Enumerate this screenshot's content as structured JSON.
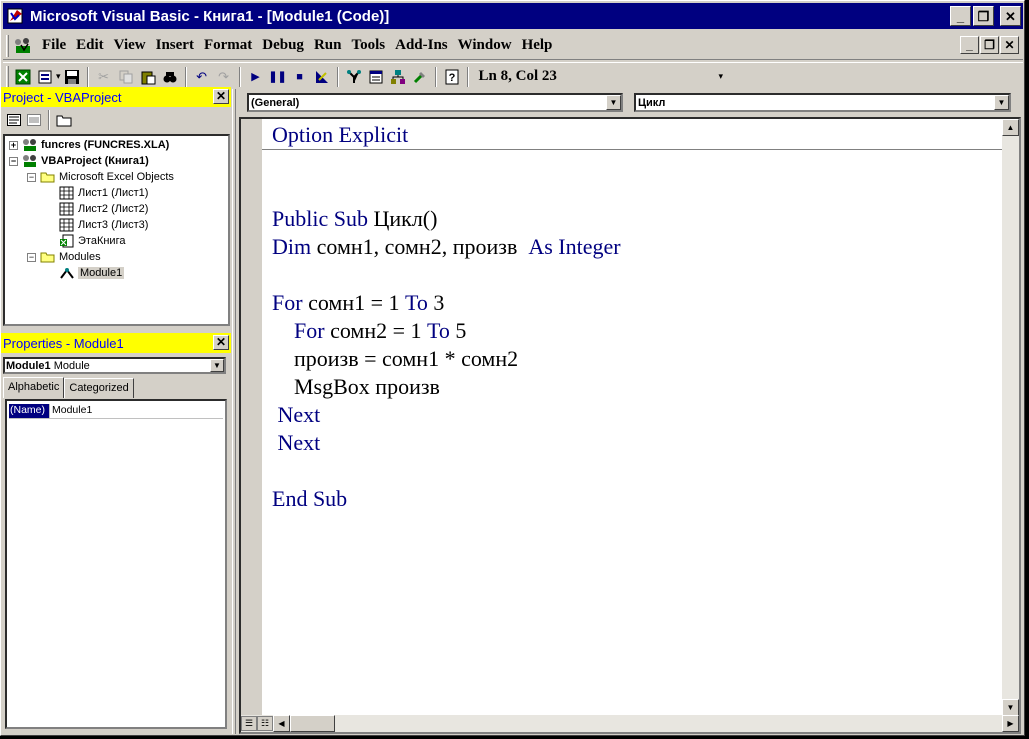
{
  "window": {
    "title": "Microsoft Visual Basic - Книга1 - [Module1 (Code)]",
    "caption_buttons": [
      "_",
      "❐",
      "✕"
    ]
  },
  "menubar": {
    "items": [
      "File",
      "Edit",
      "View",
      "Insert",
      "Format",
      "Debug",
      "Run",
      "Tools",
      "Add-Ins",
      "Window",
      "Help"
    ],
    "doc_buttons": [
      "_",
      "❐",
      "✕"
    ]
  },
  "toolbar": {
    "status": "Ln 8, Col 23",
    "icons": [
      "excel-icon",
      "insert-module-icon",
      "save-icon",
      "cut-icon",
      "copy-icon",
      "paste-icon",
      "find-icon",
      "undo-icon",
      "redo-icon",
      "run-icon",
      "break-icon",
      "reset-icon",
      "design-mode-icon",
      "project-explorer-icon",
      "properties-window-icon",
      "object-browser-icon",
      "toolbox-icon",
      "help-icon"
    ]
  },
  "project_pane": {
    "title": "Project - VBAProject",
    "close": "✕",
    "tree": [
      {
        "label": "funcres (FUNCRES.XLA)",
        "bold": true,
        "expander": "+"
      },
      {
        "label": "VBAProject (Книга1)",
        "bold": true,
        "expander": "−"
      },
      {
        "label": "Microsoft Excel Objects",
        "bold": false,
        "expander": "−"
      },
      {
        "label": "Лист1 (Лист1)",
        "bold": false
      },
      {
        "label": "Лист2 (Лист2)",
        "bold": false
      },
      {
        "label": "Лист3 (Лист3)",
        "bold": false
      },
      {
        "label": "ЭтаКнига",
        "bold": false
      },
      {
        "label": "Modules",
        "bold": false,
        "expander": "−"
      },
      {
        "label": "Module1",
        "bold": false,
        "selected": true
      }
    ]
  },
  "properties_pane": {
    "title": "Properties - Module1",
    "close": "✕",
    "object_name": "Module1",
    "object_type": "Module",
    "tabs": [
      "Alphabetic",
      "Categorized"
    ],
    "rows": [
      {
        "name": "(Name)",
        "value": "Module1"
      }
    ]
  },
  "code_window": {
    "object_combo": "(General)",
    "procedure_combo": "Цикл",
    "lines": [
      [
        {
          "t": "Option Explicit",
          "kw": true
        }
      ],
      [],
      [],
      [
        {
          "t": "Public Sub ",
          "kw": true
        },
        {
          "t": "Цикл()",
          "kw": false
        }
      ],
      [
        {
          "t": "Dim ",
          "kw": true
        },
        {
          "t": "сомн1, сомн2, произв  ",
          "kw": false
        },
        {
          "t": "As Integer",
          "kw": true
        }
      ],
      [],
      [
        {
          "t": "For ",
          "kw": true
        },
        {
          "t": "сомн1 = 1 ",
          "kw": false
        },
        {
          "t": "To ",
          "kw": true
        },
        {
          "t": "3",
          "kw": false
        }
      ],
      [
        {
          "t": "    For ",
          "kw": true
        },
        {
          "t": "сомн2 = 1 ",
          "kw": false
        },
        {
          "t": "To ",
          "kw": true
        },
        {
          "t": "5",
          "kw": false
        }
      ],
      [
        {
          "t": "    произв = сомн1 * сомн2",
          "kw": false
        }
      ],
      [
        {
          "t": "    MsgBox произв",
          "kw": false
        }
      ],
      [
        {
          "t": " Next",
          "kw": true
        }
      ],
      [
        {
          "t": " Next",
          "kw": true
        }
      ],
      [],
      [
        {
          "t": "End Sub",
          "kw": true
        }
      ]
    ]
  },
  "colors": {
    "title_bar": "#000080",
    "pane_title_bg": "#ffff00",
    "pane_title_text": "#0000ff",
    "keyword": "#000080",
    "chrome": "#d4d0c8"
  }
}
